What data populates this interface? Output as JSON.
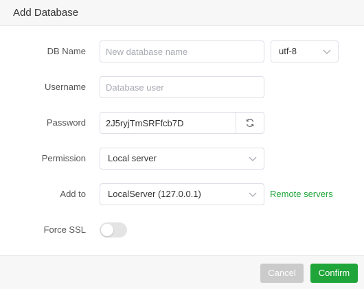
{
  "dialog": {
    "title": "Add Database"
  },
  "form": {
    "db_name": {
      "label": "DB Name",
      "placeholder": "New database name",
      "value": ""
    },
    "charset": {
      "selected": "utf-8"
    },
    "username": {
      "label": "Username",
      "placeholder": "Database user",
      "value": ""
    },
    "password": {
      "label": "Password",
      "value": "2J5ryjTmSRFfcb7D"
    },
    "permission": {
      "label": "Permission",
      "selected": "Local server"
    },
    "add_to": {
      "label": "Add to",
      "selected": "LocalServer (127.0.0.1)",
      "link": "Remote servers"
    },
    "force_ssl": {
      "label": "Force SSL",
      "enabled": false
    }
  },
  "footer": {
    "cancel_label": "Cancel",
    "confirm_label": "Confirm"
  },
  "colors": {
    "accent": "#20a53a",
    "cancel_bg": "#cbcbcb",
    "toggle_off": "#e4e4e4"
  },
  "icons": {
    "refresh": "refresh-icon",
    "chevron": "chevron-down-icon"
  }
}
